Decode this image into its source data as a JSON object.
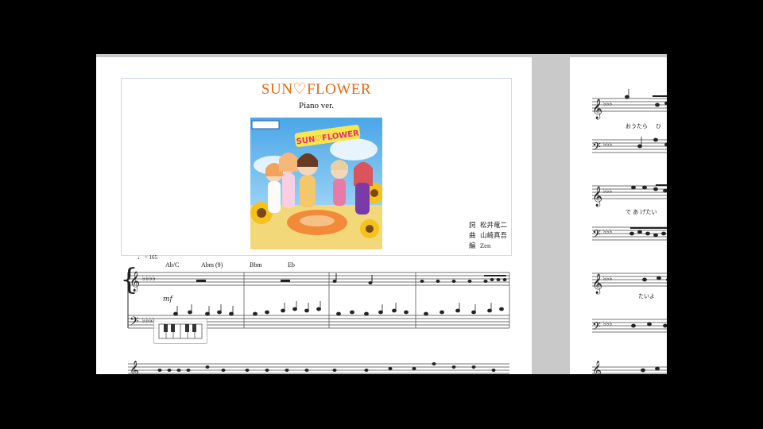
{
  "score": {
    "title": "SUN♡FLOWER",
    "subtitle": "Piano ver.",
    "cover_title": "SUN♡FLOWER",
    "credits": [
      {
        "role": "詞",
        "name": "松井竜二"
      },
      {
        "role": "曲",
        "name": "山崎真吾"
      },
      {
        "role": "編",
        "name": "Zen"
      }
    ],
    "tempo": "♩ = 165",
    "chords": [
      "Ab/C",
      "Abm (9)",
      "Bbm",
      "Eb"
    ],
    "lyrics_page2": [
      "おうたら",
      "ひ",
      "で あ げたい",
      "たいよ"
    ]
  },
  "colors": {
    "title": "#e46a10",
    "frame": "#ccd8ec",
    "workspace": "#c9c9c9"
  }
}
